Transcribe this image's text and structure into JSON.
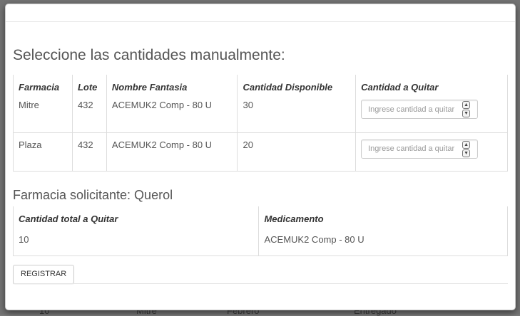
{
  "background": {
    "peek_texts": [
      "10",
      "Mitre",
      "Febrero",
      "Entregado"
    ]
  },
  "modal": {
    "heading": "Seleccione las cantidades manualmente:",
    "stock_table": {
      "headers": [
        "Farmacia",
        "Lote",
        "Nombre Fantasia",
        "Cantidad Disponible",
        "Cantidad a Quitar"
      ],
      "rows": [
        {
          "farmacia": "Mitre",
          "lote": "432",
          "nombre": "ACEMUK2 Comp - 80 U",
          "disponible": "30",
          "placeholder": "Ingrese cantidad a quitar"
        },
        {
          "farmacia": "Plaza",
          "lote": "432",
          "nombre": "ACEMUK2 Comp - 80 U",
          "disponible": "20",
          "placeholder": "Ingrese cantidad a quitar"
        }
      ]
    },
    "requesting_label": "Farmacia solicitante: Querol",
    "summary_table": {
      "headers": [
        "Cantidad total a Quitar",
        "Medicamento"
      ],
      "row": {
        "total": "10",
        "medicamento": "ACEMUK2 Comp - 80 U"
      }
    },
    "register_button": "REGISTRAR"
  }
}
